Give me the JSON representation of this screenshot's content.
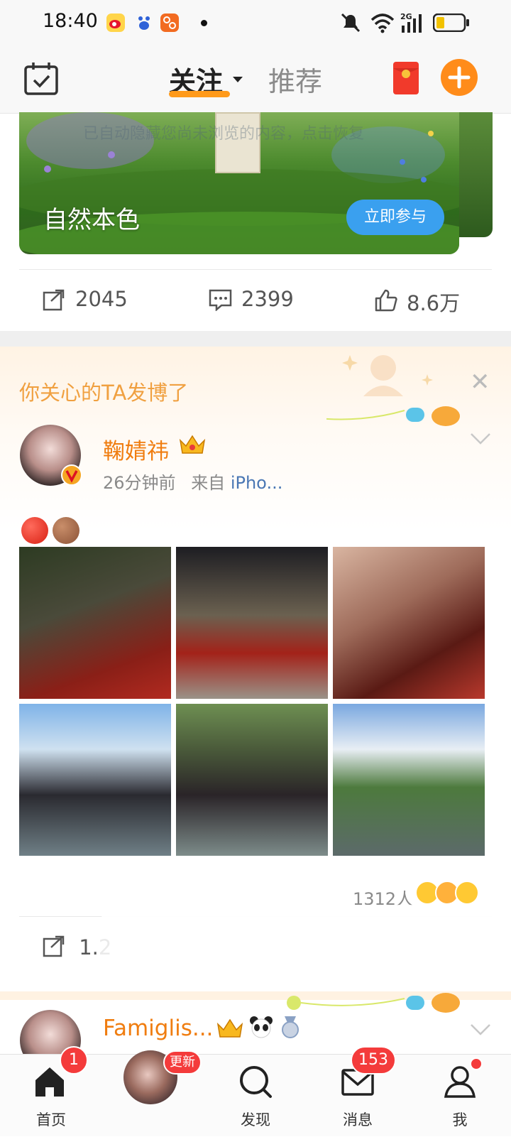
{
  "status_bar": {
    "time": "18:40",
    "icons": [
      "weibo-app-icon",
      "baidu-app-icon",
      "app-icon",
      "dot",
      "mute-icon",
      "wifi-icon",
      "signal-2g-icon",
      "battery-icon"
    ],
    "network": "2G"
  },
  "header": {
    "tabs": [
      {
        "label": "关注",
        "active": true
      },
      {
        "label": "推荐",
        "active": false
      }
    ],
    "icons": [
      "calendar-check-icon",
      "red-envelope-icon",
      "plus-icon"
    ]
  },
  "banner": {
    "faint_text": "已自动隐藏您尚未浏览的内容，点击恢复",
    "title": "自然本色",
    "button": "立即参与",
    "sign_text": "自然本色"
  },
  "post_stats": {
    "reposts": "2045",
    "comments": "2399",
    "likes": "8.6万"
  },
  "recommend_card": {
    "title": "你关心的TA发博了",
    "post": {
      "author": "鞠婧祎",
      "time": "26分钟前",
      "source_prefix": "来自",
      "source": "iPho...",
      "body_emojis": [
        "red-circle",
        "brown-circle"
      ],
      "photo_count": 6,
      "reaction_count": "1312人",
      "repost_partial": "1.2"
    },
    "next_post": {
      "author": "Famiglis..."
    }
  },
  "tabbar": {
    "items": [
      {
        "label": "首页",
        "badge": "1",
        "icon": "home-icon"
      },
      {
        "label": "",
        "badge": "更新",
        "icon": "avatar"
      },
      {
        "label": "发现",
        "badge": "",
        "icon": "discover-icon"
      },
      {
        "label": "消息",
        "badge": "153",
        "icon": "message-icon"
      },
      {
        "label": "我",
        "badge": "dot",
        "icon": "profile-icon"
      }
    ]
  },
  "colors": {
    "accent": "#ff9a1a",
    "name_orange": "#f07d10",
    "link_blue": "#4a77b4",
    "badge_red": "#f43b3b",
    "button_blue": "#3aa0ef"
  }
}
